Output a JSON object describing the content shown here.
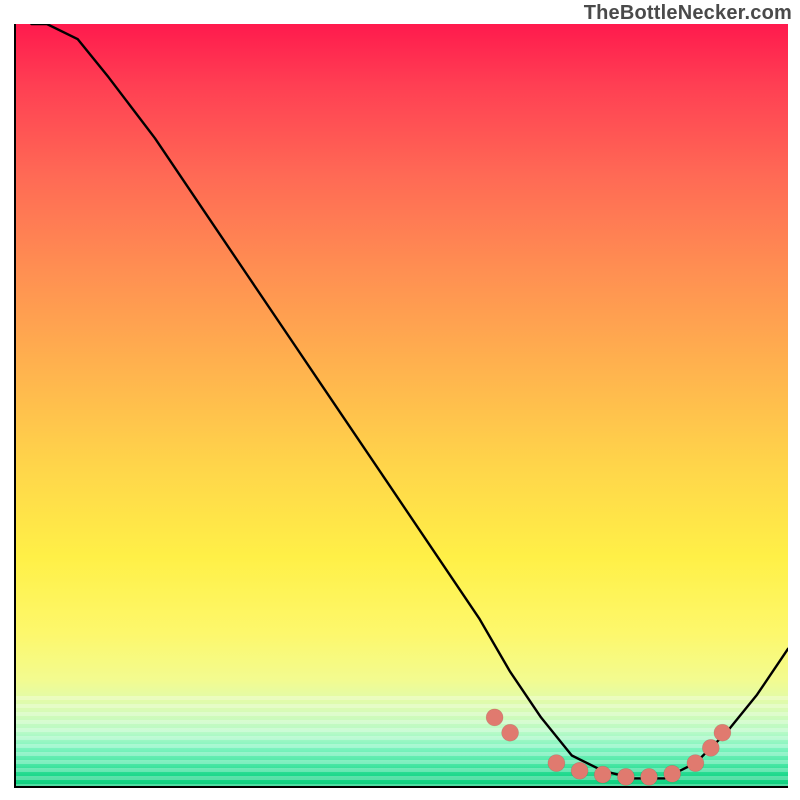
{
  "watermark": "TheBottleNecker.com",
  "chart_data": {
    "type": "line",
    "title": "",
    "xlabel": "",
    "ylabel": "",
    "xlim": [
      0,
      100
    ],
    "ylim": [
      0,
      100
    ],
    "background_gradient": [
      "#ff1a4d",
      "#ffd54a",
      "#0ccf7d"
    ],
    "series": [
      {
        "name": "curve",
        "x": [
          2,
          4,
          8,
          12,
          18,
          24,
          30,
          36,
          42,
          48,
          54,
          60,
          64,
          68,
          72,
          76,
          80,
          84,
          88,
          92,
          96,
          100
        ],
        "y": [
          100,
          100,
          98,
          93,
          85,
          76,
          67,
          58,
          49,
          40,
          31,
          22,
          15,
          9,
          4,
          2,
          1,
          1,
          3,
          7,
          12,
          18
        ]
      }
    ],
    "markers": {
      "name": "salmon-dots",
      "color": "#e07a6f",
      "points": [
        {
          "x": 62,
          "y": 9
        },
        {
          "x": 64,
          "y": 7
        },
        {
          "x": 70,
          "y": 3
        },
        {
          "x": 73,
          "y": 2
        },
        {
          "x": 76,
          "y": 1.5
        },
        {
          "x": 79,
          "y": 1.2
        },
        {
          "x": 82,
          "y": 1.2
        },
        {
          "x": 85,
          "y": 1.6
        },
        {
          "x": 88,
          "y": 3
        },
        {
          "x": 90,
          "y": 5
        },
        {
          "x": 91.5,
          "y": 7
        }
      ]
    }
  }
}
